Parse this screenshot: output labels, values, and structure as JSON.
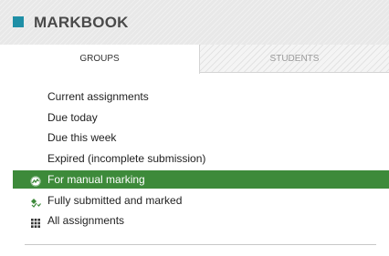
{
  "header": {
    "title": "MARKBOOK",
    "accent_color": "#1f8fa6"
  },
  "tabs": [
    {
      "label": "GROUPS",
      "active": true
    },
    {
      "label": "STUDENTS",
      "active": false
    }
  ],
  "menu": {
    "items": [
      {
        "label": "Current assignments",
        "icon": null,
        "active": false
      },
      {
        "label": "Due today",
        "icon": null,
        "active": false
      },
      {
        "label": "Due this week",
        "icon": null,
        "active": false
      },
      {
        "label": "Expired (incomplete submission)",
        "icon": null,
        "active": false
      },
      {
        "label": "For manual marking",
        "icon": "manual-marking-icon",
        "active": true
      },
      {
        "label": "Fully submitted and marked",
        "icon": "marked-icon",
        "active": false
      },
      {
        "label": "All assignments",
        "icon": "grid-icon",
        "active": false
      }
    ],
    "active_color": "#3d8a3a"
  }
}
